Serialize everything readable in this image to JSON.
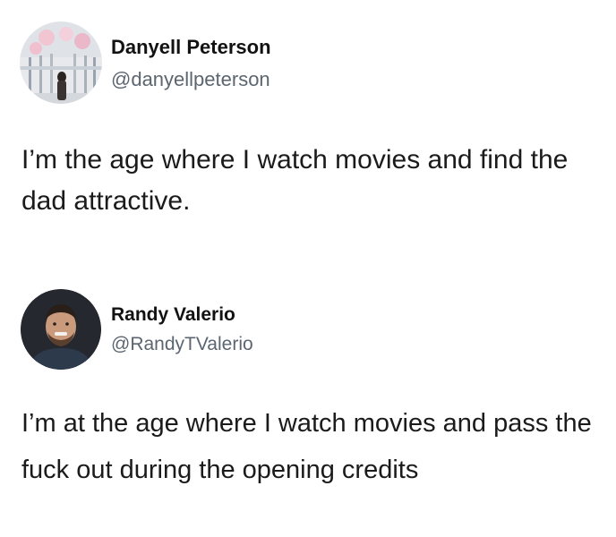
{
  "tweets": [
    {
      "display_name": "Danyell Peterson",
      "handle": "@danyellpeterson",
      "text": "I’m the age where I watch movies and find the dad attractive."
    },
    {
      "display_name": "Randy Valerio",
      "handle": "@RandyTValerio",
      "text": "I’m at the age where I watch movies and pass the fuck out during the opening credits"
    }
  ]
}
